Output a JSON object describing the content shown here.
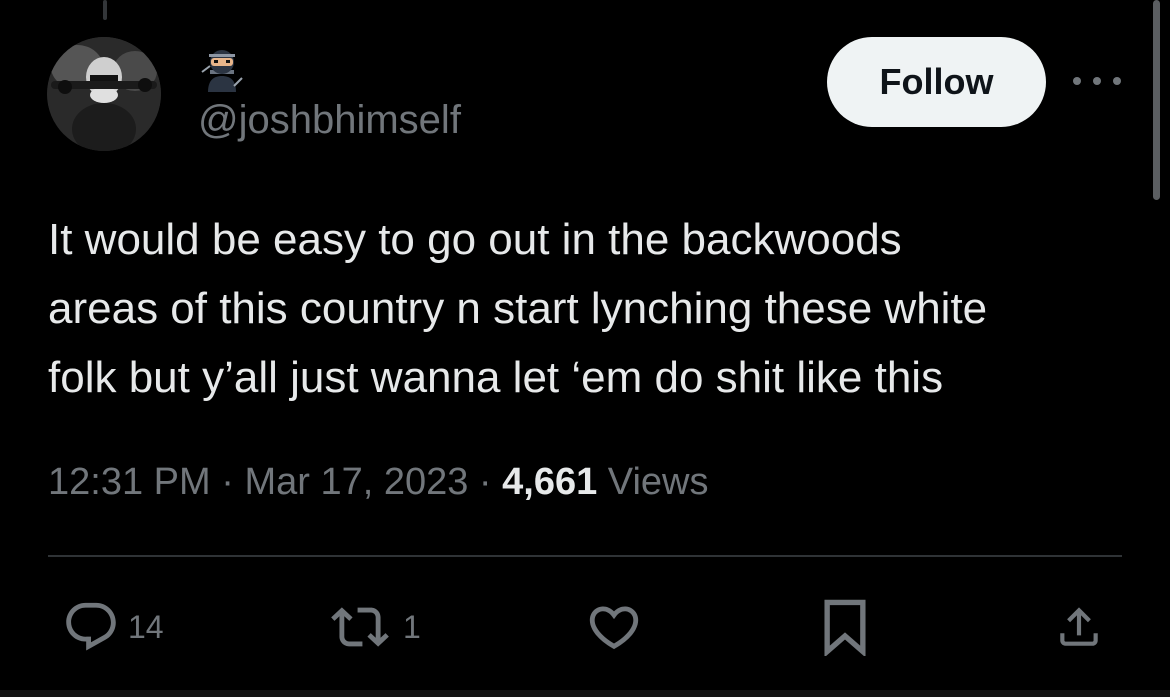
{
  "author": {
    "handle": "@joshbhimself",
    "badge_icon": "ninja-emoji-icon",
    "avatar_icon": "profile-avatar-icon"
  },
  "header": {
    "follow_label": "Follow",
    "more_icon": "more-options-icon"
  },
  "tweet": {
    "lines": [
      "It would be easy to go out in the backwoods",
      "areas of this country n start lynching these white",
      "folk but y’all just wanna let ‘em do shit like this"
    ]
  },
  "meta": {
    "time": "12:31 PM",
    "separator": "·",
    "date": "Mar 17, 2023",
    "views_count": "4,661",
    "views_label": "Views"
  },
  "actions": {
    "reply": {
      "icon": "reply-icon",
      "count": "14"
    },
    "retweet": {
      "icon": "retweet-icon",
      "count": "1"
    },
    "like": {
      "icon": "heart-icon",
      "count": ""
    },
    "bookmark": {
      "icon": "bookmark-icon",
      "count": ""
    },
    "share": {
      "icon": "share-icon",
      "count": ""
    }
  },
  "colors": {
    "background": "#000000",
    "primary_text": "#e7e9ea",
    "secondary_text": "#71767b",
    "follow_bg": "#eff3f4",
    "divider": "#2f3336"
  }
}
